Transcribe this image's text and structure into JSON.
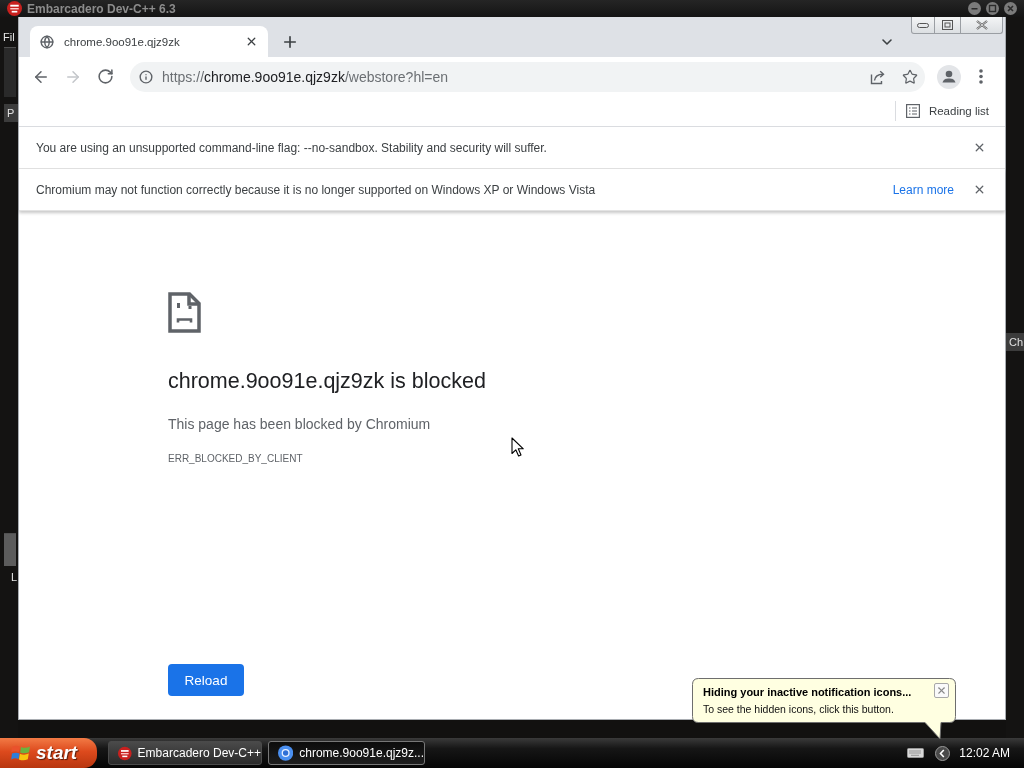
{
  "background_window": {
    "title": "Embarcadero Dev-C++ 6.3",
    "left_labels": [
      "Fil",
      "P",
      "L"
    ],
    "right_labels": [
      "Ch"
    ]
  },
  "browser": {
    "tabs": [
      {
        "title": "chrome.9oo91e.qjz9zk",
        "selected": true
      }
    ],
    "nav_buttons": [
      {
        "kind": "back",
        "disabled": false
      },
      {
        "kind": "forward",
        "disabled": true
      },
      {
        "kind": "reload",
        "disabled": false
      }
    ],
    "address_bar": {
      "scheme": "https://",
      "host": "chrome.9oo91e.qjz9zk",
      "path": "/webstore?hl=en"
    },
    "bookmarks_bar": {
      "reading_list": "Reading list"
    },
    "infobars": [
      {
        "message": "You are using an unsupported command-line flag: --no-sandbox. Stability and security will suffer."
      },
      {
        "message": "Chromium may not function correctly because it is no longer supported on Windows XP or Windows Vista",
        "link": "Learn more"
      }
    ],
    "error_page": {
      "title": "chrome.9oo91e.qjz9zk is blocked",
      "description": "This page has been blocked by Chromium",
      "error_code": "ERR_BLOCKED_BY_CLIENT",
      "button": "Reload"
    }
  },
  "notification_balloon": {
    "title": "Hiding your inactive notification icons...",
    "text": "To see the hidden icons, click this button."
  },
  "taskbar": {
    "start": "start",
    "buttons": [
      {
        "label": "Embarcadero Dev-C++",
        "kind": "devcpp",
        "selected": false
      },
      {
        "label": "chrome.9oo91e.qjz9z...",
        "kind": "chrome",
        "selected": true
      }
    ],
    "clock": "12:02 AM"
  }
}
